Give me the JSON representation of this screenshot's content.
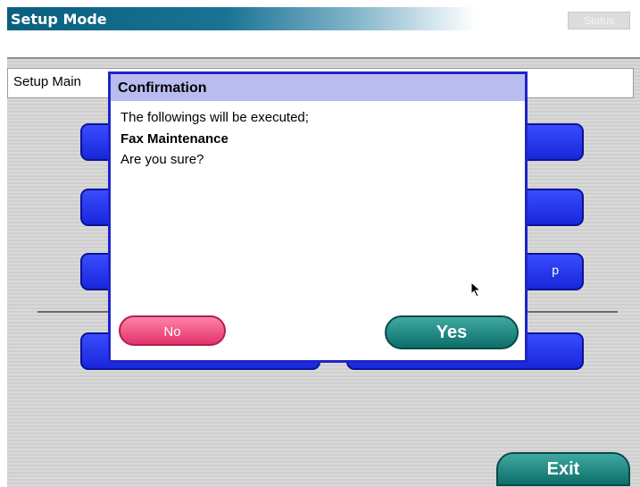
{
  "window": {
    "title": "Setup Mode",
    "status_label": "Status"
  },
  "breadcrumb": {
    "text": "Setup Main"
  },
  "background_buttons": {
    "partial_label": "p"
  },
  "dialog": {
    "title": "Confirmation",
    "line1": "The followings will be executed;",
    "line2": "Fax Maintenance",
    "line3": "Are you sure?",
    "no_label": "No",
    "yes_label": "Yes"
  },
  "footer": {
    "exit_label": "Exit"
  },
  "colors": {
    "title_bar": "#0a5f7f",
    "dialog_border": "#1f23c8",
    "dialog_header": "#b9bcef",
    "no_button": "#e2336b",
    "yes_button": "#0d6e69",
    "menu_button": "#1727d9"
  }
}
